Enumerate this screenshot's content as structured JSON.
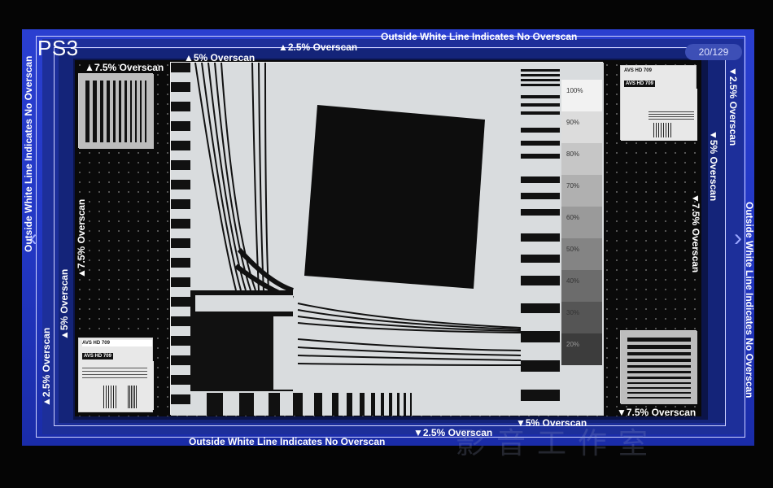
{
  "window": {
    "title": "PS3",
    "page_counter": "20/129"
  },
  "overscan_labels": {
    "outer_top": "Outside White Line Indicates No Overscan",
    "outer_bottom": "Outside White Line Indicates No Overscan",
    "outer_left": "Outside White Line Indicates No Overscan",
    "outer_right": "Outside White Line Indicates No Overscan",
    "top_2_5": "▲2.5% Overscan",
    "top_5": "▲5% Overscan",
    "top_7_5": "▲7.5% Overscan",
    "bottom_2_5": "▼2.5% Overscan",
    "bottom_5": "▼5% Overscan",
    "bottom_7_5": "▼7.5% Overscan",
    "left_2_5": "▲2.5% Overscan",
    "left_5": "▲5% Overscan",
    "left_7_5": "▲7.5% Overscan",
    "right_2_5": "▼2.5% Overscan",
    "right_5": "▼5% Overscan",
    "right_7_5": "▼7.5% Overscan"
  },
  "grayscale_steps": [
    "100%",
    "90%",
    "80%",
    "70%",
    "60%",
    "50%",
    "40%",
    "30%",
    "20%"
  ],
  "tile_text": {
    "avs_a": "AVS HD 709",
    "avs_b": "AVS HD 709",
    "avs_c": "AVS HD 709",
    "avs_d": "AVS HD 709"
  },
  "navigation": {
    "prev_icon": "chevron-left-icon",
    "next_icon": "chevron-right-icon",
    "prev_glyph": "‹",
    "next_glyph": "›"
  },
  "watermark": "影音工作室",
  "colors": {
    "outer_blue": "#2237c4",
    "inner_black": "#0a0a0a",
    "panel_gray": "#d9dcde"
  }
}
